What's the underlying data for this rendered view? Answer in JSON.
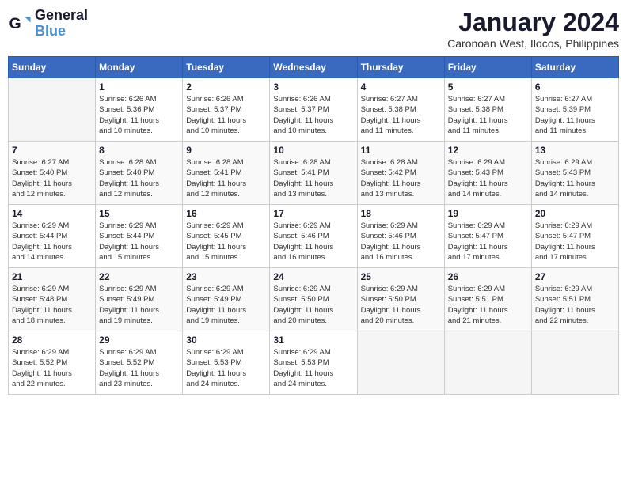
{
  "header": {
    "logo_line1": "General",
    "logo_line2": "Blue",
    "month_title": "January 2024",
    "subtitle": "Caronoan West, Ilocos, Philippines"
  },
  "days_of_week": [
    "Sunday",
    "Monday",
    "Tuesday",
    "Wednesday",
    "Thursday",
    "Friday",
    "Saturday"
  ],
  "weeks": [
    [
      {
        "num": "",
        "info": ""
      },
      {
        "num": "1",
        "info": "Sunrise: 6:26 AM\nSunset: 5:36 PM\nDaylight: 11 hours\nand 10 minutes."
      },
      {
        "num": "2",
        "info": "Sunrise: 6:26 AM\nSunset: 5:37 PM\nDaylight: 11 hours\nand 10 minutes."
      },
      {
        "num": "3",
        "info": "Sunrise: 6:26 AM\nSunset: 5:37 PM\nDaylight: 11 hours\nand 10 minutes."
      },
      {
        "num": "4",
        "info": "Sunrise: 6:27 AM\nSunset: 5:38 PM\nDaylight: 11 hours\nand 11 minutes."
      },
      {
        "num": "5",
        "info": "Sunrise: 6:27 AM\nSunset: 5:38 PM\nDaylight: 11 hours\nand 11 minutes."
      },
      {
        "num": "6",
        "info": "Sunrise: 6:27 AM\nSunset: 5:39 PM\nDaylight: 11 hours\nand 11 minutes."
      }
    ],
    [
      {
        "num": "7",
        "info": "Sunrise: 6:27 AM\nSunset: 5:40 PM\nDaylight: 11 hours\nand 12 minutes."
      },
      {
        "num": "8",
        "info": "Sunrise: 6:28 AM\nSunset: 5:40 PM\nDaylight: 11 hours\nand 12 minutes."
      },
      {
        "num": "9",
        "info": "Sunrise: 6:28 AM\nSunset: 5:41 PM\nDaylight: 11 hours\nand 12 minutes."
      },
      {
        "num": "10",
        "info": "Sunrise: 6:28 AM\nSunset: 5:41 PM\nDaylight: 11 hours\nand 13 minutes."
      },
      {
        "num": "11",
        "info": "Sunrise: 6:28 AM\nSunset: 5:42 PM\nDaylight: 11 hours\nand 13 minutes."
      },
      {
        "num": "12",
        "info": "Sunrise: 6:29 AM\nSunset: 5:43 PM\nDaylight: 11 hours\nand 14 minutes."
      },
      {
        "num": "13",
        "info": "Sunrise: 6:29 AM\nSunset: 5:43 PM\nDaylight: 11 hours\nand 14 minutes."
      }
    ],
    [
      {
        "num": "14",
        "info": "Sunrise: 6:29 AM\nSunset: 5:44 PM\nDaylight: 11 hours\nand 14 minutes."
      },
      {
        "num": "15",
        "info": "Sunrise: 6:29 AM\nSunset: 5:44 PM\nDaylight: 11 hours\nand 15 minutes."
      },
      {
        "num": "16",
        "info": "Sunrise: 6:29 AM\nSunset: 5:45 PM\nDaylight: 11 hours\nand 15 minutes."
      },
      {
        "num": "17",
        "info": "Sunrise: 6:29 AM\nSunset: 5:46 PM\nDaylight: 11 hours\nand 16 minutes."
      },
      {
        "num": "18",
        "info": "Sunrise: 6:29 AM\nSunset: 5:46 PM\nDaylight: 11 hours\nand 16 minutes."
      },
      {
        "num": "19",
        "info": "Sunrise: 6:29 AM\nSunset: 5:47 PM\nDaylight: 11 hours\nand 17 minutes."
      },
      {
        "num": "20",
        "info": "Sunrise: 6:29 AM\nSunset: 5:47 PM\nDaylight: 11 hours\nand 17 minutes."
      }
    ],
    [
      {
        "num": "21",
        "info": "Sunrise: 6:29 AM\nSunset: 5:48 PM\nDaylight: 11 hours\nand 18 minutes."
      },
      {
        "num": "22",
        "info": "Sunrise: 6:29 AM\nSunset: 5:49 PM\nDaylight: 11 hours\nand 19 minutes."
      },
      {
        "num": "23",
        "info": "Sunrise: 6:29 AM\nSunset: 5:49 PM\nDaylight: 11 hours\nand 19 minutes."
      },
      {
        "num": "24",
        "info": "Sunrise: 6:29 AM\nSunset: 5:50 PM\nDaylight: 11 hours\nand 20 minutes."
      },
      {
        "num": "25",
        "info": "Sunrise: 6:29 AM\nSunset: 5:50 PM\nDaylight: 11 hours\nand 20 minutes."
      },
      {
        "num": "26",
        "info": "Sunrise: 6:29 AM\nSunset: 5:51 PM\nDaylight: 11 hours\nand 21 minutes."
      },
      {
        "num": "27",
        "info": "Sunrise: 6:29 AM\nSunset: 5:51 PM\nDaylight: 11 hours\nand 22 minutes."
      }
    ],
    [
      {
        "num": "28",
        "info": "Sunrise: 6:29 AM\nSunset: 5:52 PM\nDaylight: 11 hours\nand 22 minutes."
      },
      {
        "num": "29",
        "info": "Sunrise: 6:29 AM\nSunset: 5:52 PM\nDaylight: 11 hours\nand 23 minutes."
      },
      {
        "num": "30",
        "info": "Sunrise: 6:29 AM\nSunset: 5:53 PM\nDaylight: 11 hours\nand 24 minutes."
      },
      {
        "num": "31",
        "info": "Sunrise: 6:29 AM\nSunset: 5:53 PM\nDaylight: 11 hours\nand 24 minutes."
      },
      {
        "num": "",
        "info": ""
      },
      {
        "num": "",
        "info": ""
      },
      {
        "num": "",
        "info": ""
      }
    ]
  ]
}
